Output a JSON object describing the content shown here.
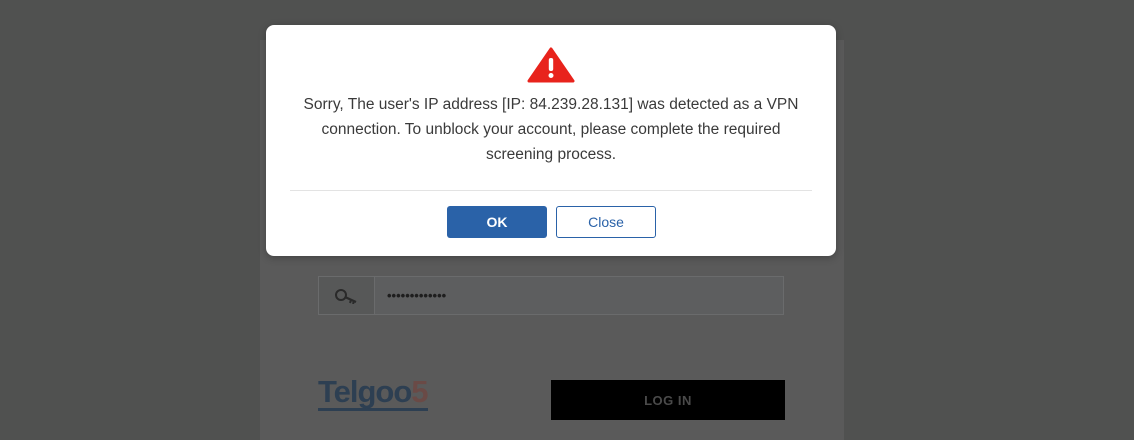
{
  "modal": {
    "icon": "warning-triangle-icon",
    "icon_color": "#e8231c",
    "message": "Sorry, The user's IP address [IP: 84.239.28.131] was detected as a VPN connection. To unblock your account, please complete the required screening process.",
    "ok_label": "OK",
    "close_label": "Close",
    "accent": "#2a62a8"
  },
  "login": {
    "password_icon": "key-icon",
    "password_value": "•••••••••••••",
    "logo_text_main": "Telgoo",
    "logo_text_accent": "5",
    "login_label": "LOG IN"
  }
}
